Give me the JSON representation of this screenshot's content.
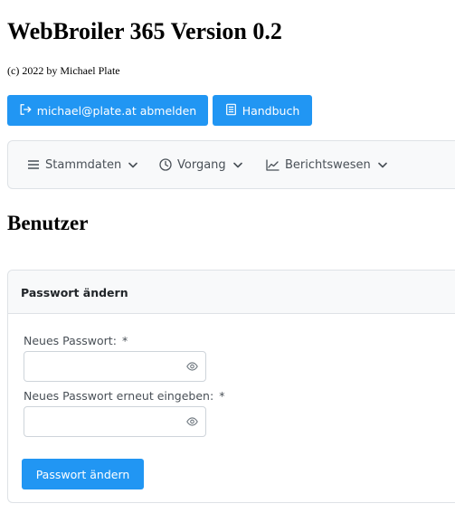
{
  "header": {
    "title": "WebBroiler 365 Version 0.2",
    "copyright": "(c) 2022 by Michael Plate"
  },
  "toolbar": {
    "logout_label": "michael@plate.at abmelden",
    "logout_icon": "logout-icon",
    "manual_label": "Handbuch",
    "manual_icon": "book-icon"
  },
  "menu": {
    "items": [
      {
        "label": "Stammdaten",
        "icon": "hamburger-icon"
      },
      {
        "label": "Vorgang",
        "icon": "clock-icon"
      },
      {
        "label": "Berichtswesen",
        "icon": "chart-line-icon"
      }
    ]
  },
  "page": {
    "title": "Benutzer"
  },
  "form": {
    "header": "Passwort ändern",
    "new_password_label": "Neues Passwort:",
    "repeat_password_label": "Neues Passwort erneut eingeben:",
    "required_marker": "*",
    "new_password_value": "",
    "repeat_password_value": "",
    "submit_label": "Passwort ändern"
  },
  "colors": {
    "primary": "#2196f3",
    "menu_bg": "#f8f9fa",
    "border": "#dee2e6"
  }
}
